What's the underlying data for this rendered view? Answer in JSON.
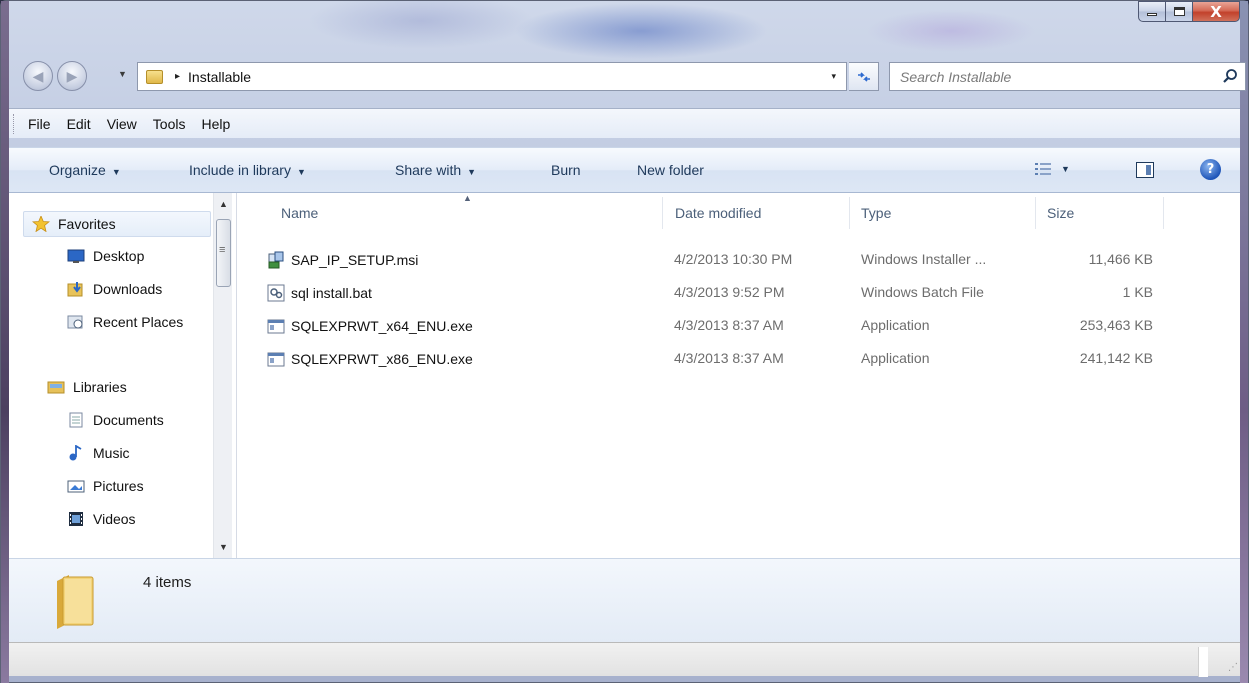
{
  "window": {
    "close_glyph": "X"
  },
  "address": {
    "crumb_arrow": "▸",
    "current_folder": "Installable",
    "dropdown": "▾"
  },
  "search": {
    "placeholder": "Search Installable"
  },
  "menu": [
    "File",
    "Edit",
    "View",
    "Tools",
    "Help"
  ],
  "toolbar": {
    "organize": "Organize",
    "include_in_library": "Include in library",
    "share_with": "Share with",
    "burn": "Burn",
    "new_folder": "New folder",
    "dropdown_glyph": "▼",
    "help_glyph": "?"
  },
  "nav": {
    "favorites": "Favorites",
    "desktop": "Desktop",
    "downloads": "Downloads",
    "recent_places": "Recent Places",
    "libraries": "Libraries",
    "documents": "Documents",
    "music": "Music",
    "pictures": "Pictures",
    "videos": "Videos"
  },
  "columns": {
    "name": "Name",
    "date_modified": "Date modified",
    "type": "Type",
    "size": "Size"
  },
  "files": [
    {
      "name": "SAP_IP_SETUP.msi",
      "date": "4/2/2013 10:30 PM",
      "type": "Windows Installer ...",
      "size": "11,466 KB",
      "icon": "msi-installer-icon"
    },
    {
      "name": "sql install.bat",
      "date": "4/3/2013 9:52 PM",
      "type": "Windows Batch File",
      "size": "1 KB",
      "icon": "batch-file-icon"
    },
    {
      "name": "SQLEXPRWT_x64_ENU.exe",
      "date": "4/3/2013 8:37 AM",
      "type": "Application",
      "size": "253,463 KB",
      "icon": "application-icon"
    },
    {
      "name": "SQLEXPRWT_x86_ENU.exe",
      "date": "4/3/2013 8:37 AM",
      "type": "Application",
      "size": "241,142 KB",
      "icon": "application-icon"
    }
  ],
  "details": {
    "item_count": "4 items"
  },
  "colors": {
    "command_text": "#1e395b",
    "column_header_text": "#4c607a",
    "secondary_text": "#6d6d6d",
    "close_button": "#c2412b"
  }
}
